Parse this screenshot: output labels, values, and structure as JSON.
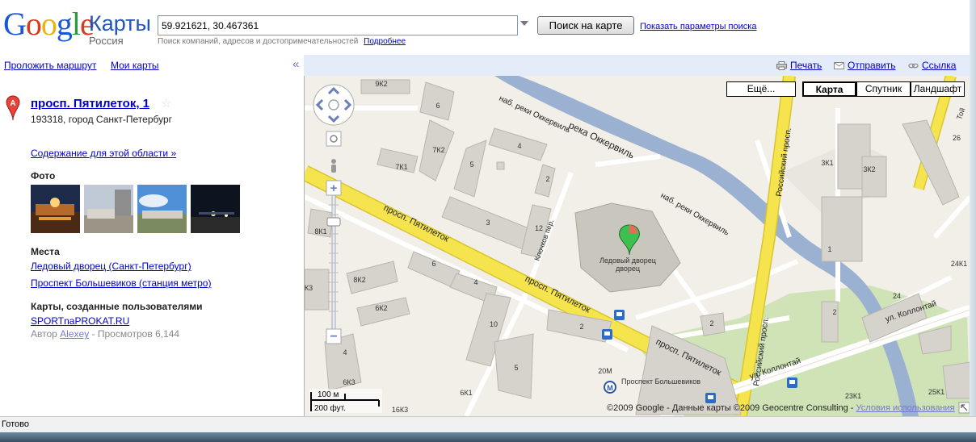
{
  "header": {
    "logo_letters": [
      "G",
      "o",
      "o",
      "g",
      "l",
      "e"
    ],
    "product": "Карты",
    "region": "Россия",
    "search_value": "59.921621, 30.467361",
    "search_button": "Поиск на карте",
    "search_options_link": "Показать параметры поиска",
    "search_hint": "Поиск компаний, адресов и достопримечательностей",
    "search_hint_more": "Подробнее"
  },
  "toolbar": {
    "route_link": "Проложить маршрут",
    "my_maps_link": "Мои карты",
    "collapse_glyph": "«",
    "print": "Печать",
    "send": "Отправить",
    "link": "Ссылка"
  },
  "result": {
    "marker_letter": "A",
    "title": "просп. Пятилеток, 1",
    "address": "193318, город Санкт-Петербург",
    "area_content_link": "Содержание для этой области »",
    "photos_title": "Фото",
    "places_title": "Места",
    "places": [
      "Ледовый дворец (Санкт-Петербург)",
      "Проспект Большевиков (станция метро)"
    ],
    "user_maps_title": "Карты, созданные пользователями",
    "user_map_link": "SPORTnaPROKAT.RU",
    "user_map_author_prefix": "Автор",
    "user_map_author": "Alexey",
    "user_map_views": "- Просмотров 6,144"
  },
  "map": {
    "types": {
      "more": "Ещё...",
      "map": "Карта",
      "satellite": "Спутник",
      "terrain": "Ландшафт"
    },
    "selected_type": "Карта",
    "scale_metric": "100 м",
    "scale_imperial": "200 фут.",
    "copyright": "©2009 Google - Данные карты ©2009 Geocentre Consulting -",
    "terms_link": "Условия использования",
    "streets": {
      "pyatiletok_1": "просп. Пятилеток",
      "pyatiletok_2": "просп. Пятилеток",
      "pyatiletok_3": "просп. Пятилеток",
      "okkervil_river": "река Оккервиль",
      "okkervil_emb_1": "наб. реки Оккервиль",
      "okkervil_emb_2": "наб. реки Оккервиль",
      "rossiysky_1": "Российский просп.",
      "rossiysky_2": "Российский просп.",
      "kollontai_1": "ул. Коллонтай",
      "kollontai_2": "ул. Коллонтай",
      "klochkov": "Клочков пер."
    },
    "poi": {
      "ice_palace": "Ледовый дворец",
      "metro": "Проспект Большевиков",
      "metro_letter": "М"
    },
    "house_numbers": [
      "9К2",
      "6",
      "7К2",
      "4",
      "7К1",
      "5",
      "2",
      "3",
      "12",
      "8К1",
      "6",
      "4",
      "8К2",
      "6К2",
      "10",
      "2",
      "2",
      "5",
      "20М",
      "6К3",
      "6К1",
      "16К3",
      "3К1",
      "3К2",
      "1",
      "26",
      "24К1",
      "24",
      "23К1",
      "25К1",
      "2",
      "К3",
      "4",
      "Той"
    ]
  },
  "status": {
    "text": "Готово"
  },
  "colors": {
    "google_blue": "#1a57d8",
    "google_red": "#d73a1c",
    "google_yellow": "#e8b30b",
    "google_green": "#2d9a3c",
    "major_road": "#f5e44d",
    "river": "#9bb1d1",
    "park": "#cfe3b7",
    "building": "#d6d3cc",
    "map_bg": "#f2efe9",
    "toolbar_bg": "#e5ecf9",
    "link": "#0000cc"
  }
}
